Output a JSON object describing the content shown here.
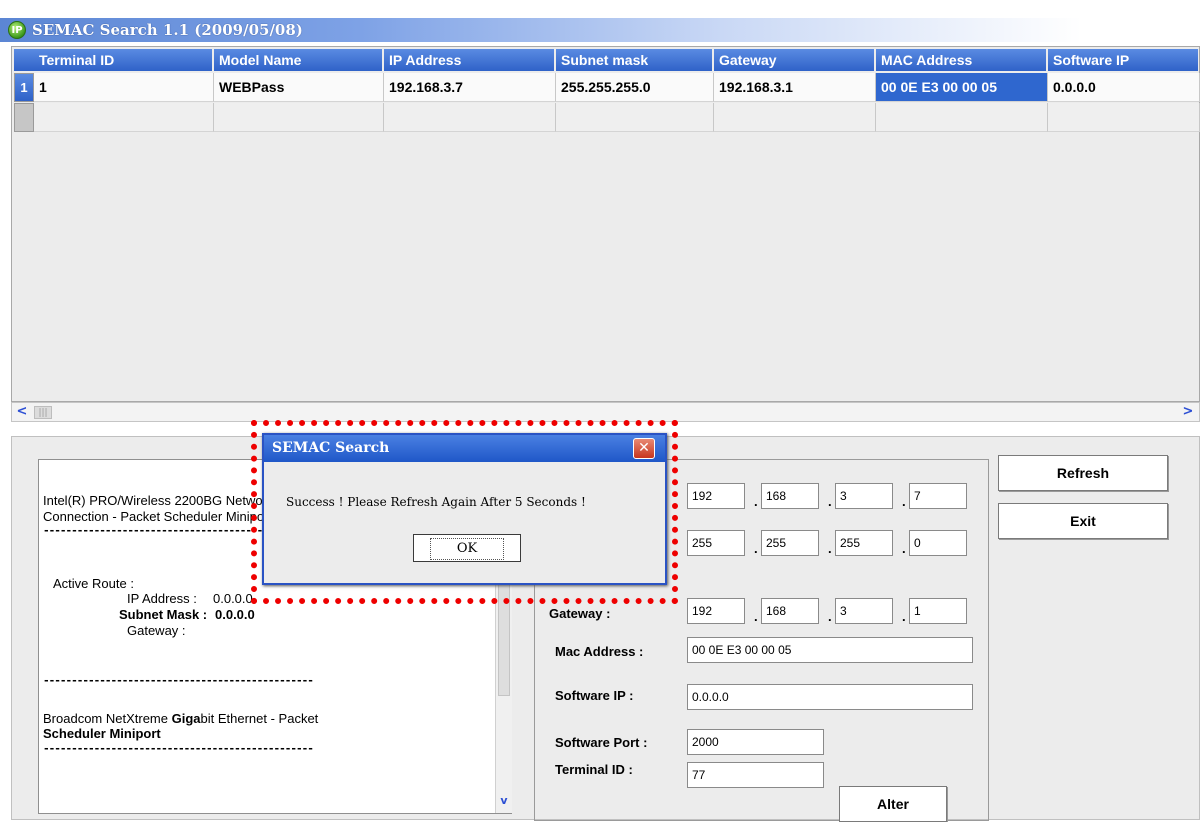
{
  "window": {
    "title": "SEMAC Search 1.1 (2009/05/08)",
    "icon": "app-globe-icon"
  },
  "grid": {
    "columns": [
      "Terminal ID",
      "Model Name",
      "IP Address",
      "Subnet mask",
      "Gateway",
      "MAC Address",
      "Software IP"
    ],
    "rows": [
      {
        "row_number": "1",
        "cells": [
          "1",
          "WEBPass",
          "192.168.3.7",
          "255.255.255.0",
          "192.168.3.1",
          "00 0E E3 00 00 05",
          "0.0.0.0"
        ],
        "selected_column": "MAC Address"
      }
    ]
  },
  "scrollbar": {
    "left_arrow": "<",
    "right_arrow": ">",
    "thumb": "|||"
  },
  "network_info": {
    "adapter1_line1": "Intel(R) PRO/Wireless 2200BG Network",
    "adapter1_line2": "Connection - Packet Scheduler Miniport",
    "separator": "------------------------------------------------",
    "active_route": "Active Route :",
    "ip_label": "IP Address :",
    "ip_value": "0.0.0.0",
    "mask_label": "Subnet Mask :",
    "mask_value": "0.0.0.0",
    "gw_label": "Gateway :",
    "adapter2_line1_a": "Broadcom NetXtreme ",
    "adapter2_line1_b": "Giga",
    "adapter2_line1_c": "bit Ethernet - Packet",
    "adapter2_line2": "Scheduler Miniport",
    "scroll_down": "v"
  },
  "fields": {
    "ip_address": [
      "192",
      "168",
      "3",
      "7"
    ],
    "subnet_mask": [
      "255",
      "255",
      "255",
      "0"
    ],
    "gateway_label": "Gateway :",
    "gateway": [
      "192",
      "168",
      "3",
      "1"
    ],
    "mac_label": "Mac Address :",
    "mac_value": "00 0E E3 00 00 05",
    "software_ip_label": "Software IP :",
    "software_ip_value": "0.0.0.0",
    "software_port_label": "Software Port :",
    "software_port_value": "2000",
    "terminal_id_label": "Terminal ID :",
    "terminal_id_value": "77",
    "dot": "."
  },
  "buttons": {
    "refresh": "Refresh",
    "exit": "Exit",
    "alter": "Alter"
  },
  "dialog": {
    "title": "SEMAC Search",
    "message": "Success ! Please Refresh Again After 5 Seconds !",
    "ok": "OK",
    "close": "✕",
    "highlight_color": "#ee0000"
  }
}
